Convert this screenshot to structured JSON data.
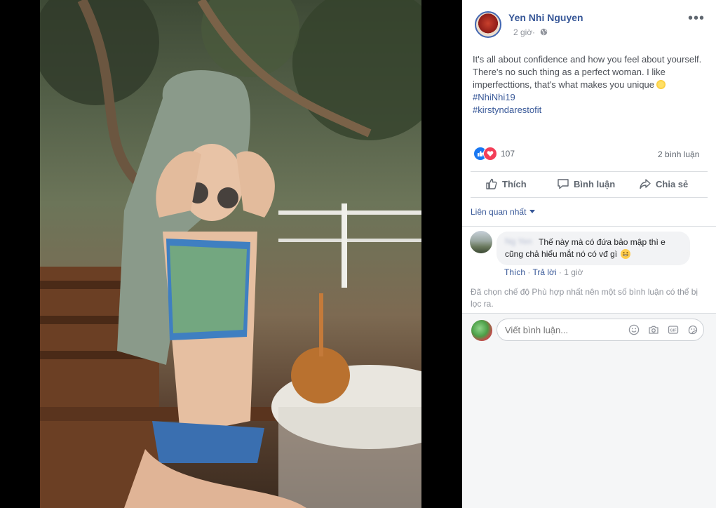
{
  "post": {
    "author": "Yen Nhi Nguyen",
    "time": "2 giờ",
    "time_separator": "·",
    "more_label": "•••",
    "caption": "It's all about confidence and how you feel about yourself. There's no such thing as a perfect woman. I like imperfecttions, that's what makes you unique",
    "hashtags": [
      "#NhiNhi19",
      "#kirstyndarestofit"
    ],
    "reaction_count": "107",
    "comment_count": "2 bình luận"
  },
  "actions": {
    "like": "Thích",
    "comment": "Bình luận",
    "share": "Chia sẻ"
  },
  "comments": {
    "sort_label": "Liên quan nhất",
    "items": [
      {
        "author": "Ng Yen",
        "text": "Thế này mà có đứa bảo mập thì e cũng chả hiểu mắt nó có vđ gì",
        "like": "Thích",
        "reply": "Trả lời",
        "time": "1 giờ"
      }
    ],
    "filter_notice": "Đã chọn chế độ Phù hợp nhất nên một số bình luận có thể bị lọc ra."
  },
  "composer": {
    "placeholder": "Viết bình luận..."
  },
  "icons": {
    "emoji": "smiley-icon",
    "camera": "camera-icon",
    "gif": "gif-icon",
    "sticker": "sticker-icon",
    "globe": "globe-icon"
  },
  "colors": {
    "link": "#385898",
    "like_blue": "#1877f2",
    "love_red": "#f33e58"
  }
}
